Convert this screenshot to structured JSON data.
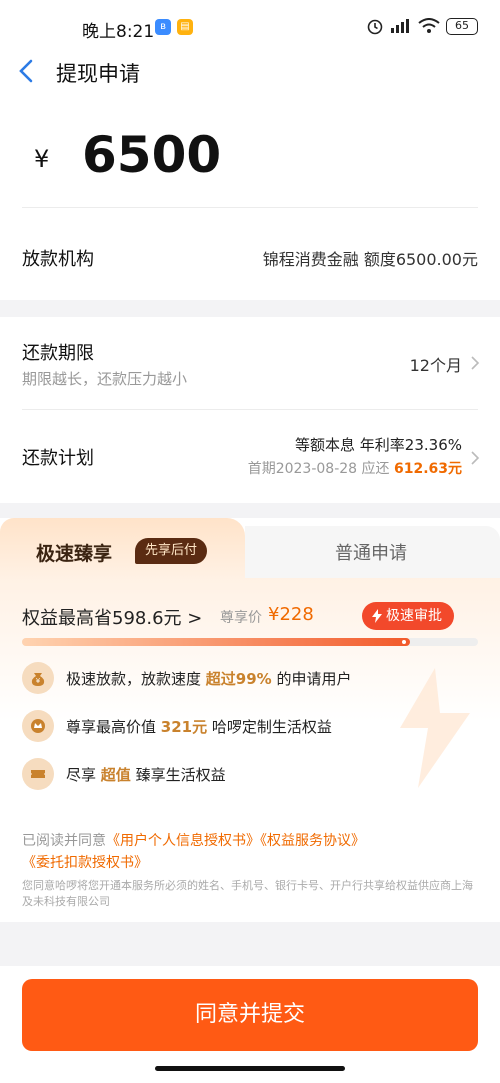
{
  "status": {
    "time": "晚上8:21",
    "battery": "65"
  },
  "header": {
    "title": "提现申请"
  },
  "amount": {
    "currency": "¥",
    "value": "6500"
  },
  "lender": {
    "label": "放款机构",
    "value": "锦程消费金融 额度6500.00元"
  },
  "term": {
    "label": "还款期限",
    "hint": "期限越长，还款压力越小",
    "value": "12个月"
  },
  "plan": {
    "label": "还款计划",
    "method": "等额本息 年利率23.36%",
    "first_prefix": "首期2023-08-28 应还 ",
    "first_amount": "612.63元"
  },
  "tabs": {
    "fast": "极速臻享",
    "fast_badge": "先享后付",
    "normal": "普通申请"
  },
  "vip": {
    "save_text": "权益最高省598.6元 >",
    "enjoy_label": "尊享价",
    "enjoy_price": "¥228",
    "fast_pill": "极速审批",
    "progress_fraction": 0.85
  },
  "benefits": [
    {
      "pre": "极速放款，放款速度 ",
      "hl": "超过99%",
      "post": " 的申请用户"
    },
    {
      "pre": "尊享最高价值 ",
      "hl": "321元",
      "post": " 哈啰定制生活权益"
    },
    {
      "pre": "尽享 ",
      "hl": "超值",
      "post": " 臻享生活权益"
    }
  ],
  "agreement": {
    "prefix": "已阅读并同意",
    "links": [
      "《用户个人信息授权书》",
      "《权益服务协议》",
      "《委托扣款授权书》"
    ],
    "note": "您同意哈啰将您开通本服务所必须的姓名、手机号、银行卡号、开户行共享给权益供应商上海及未科技有限公司"
  },
  "submit_label": "同意并提交",
  "colors": {
    "accent": "#ff5a14",
    "highlight": "#f06a00",
    "gold": "#c9822d",
    "pill": "#f2492b"
  }
}
